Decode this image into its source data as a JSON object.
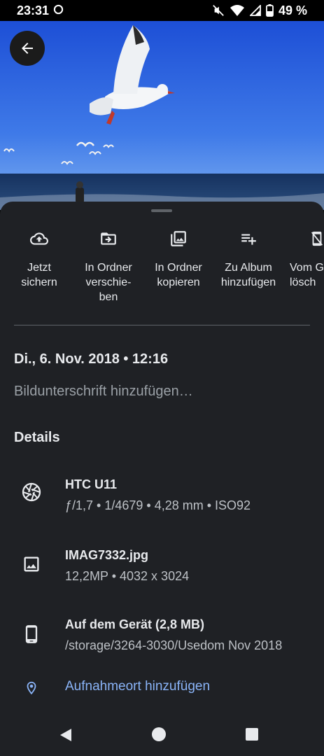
{
  "status_bar": {
    "time": "23:31",
    "battery": "49 %"
  },
  "actions": [
    {
      "icon": "cloud-upload-icon",
      "label": "Jetzt\nsichern"
    },
    {
      "icon": "folder-move-icon",
      "label": "In Ordner\nverschie-\nben"
    },
    {
      "icon": "copy-to-folder-icon",
      "label": "In Ordner\nkopieren"
    },
    {
      "icon": "playlist-add-icon",
      "label": "Zu Album\nhinzufügen"
    },
    {
      "icon": "delete-from-device-icon",
      "label": "Vom G\nlösch"
    }
  ],
  "photo": {
    "date_time": "Di., 6. Nov. 2018  •  12:16"
  },
  "caption_placeholder": "Bildunterschrift hinzufügen…",
  "details": {
    "title": "Details",
    "camera": {
      "name": "HTC U11",
      "specs": "ƒ/1,7  •  1/4679  •  4,28 mm  •  ISO92"
    },
    "file": {
      "name": "IMAG7332.jpg",
      "specs": "12,2MP  •  4032 x 3024"
    },
    "storage": {
      "name": "Auf dem Gerät (2,8 MB)",
      "path": "/storage/3264-3030/Usedom Nov 2018"
    },
    "location_label": "Aufnahmeort hinzufügen"
  }
}
